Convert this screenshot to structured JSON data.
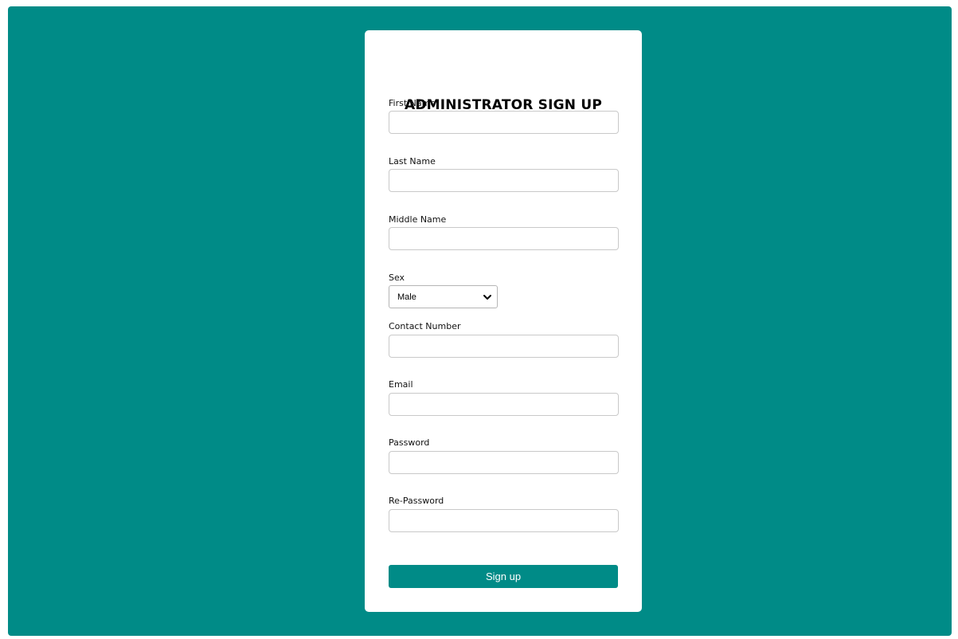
{
  "theme": {
    "accent": "#008b87",
    "card_background": "#ffffff"
  },
  "form": {
    "title": "ADMINISTRATOR SIGN UP",
    "fields": {
      "first_name": {
        "label": "First Name",
        "value": ""
      },
      "last_name": {
        "label": "Last Name",
        "value": ""
      },
      "middle_name": {
        "label": "Middle Name",
        "value": ""
      },
      "sex": {
        "label": "Sex",
        "selected": "Male",
        "icon": "chevron-down-icon"
      },
      "contact_number": {
        "label": "Contact Number",
        "value": ""
      },
      "email": {
        "label": "Email",
        "value": ""
      },
      "password": {
        "label": "Password",
        "value": ""
      },
      "re_password": {
        "label": "Re-Password",
        "value": ""
      }
    },
    "submit_label": "Sign up"
  }
}
